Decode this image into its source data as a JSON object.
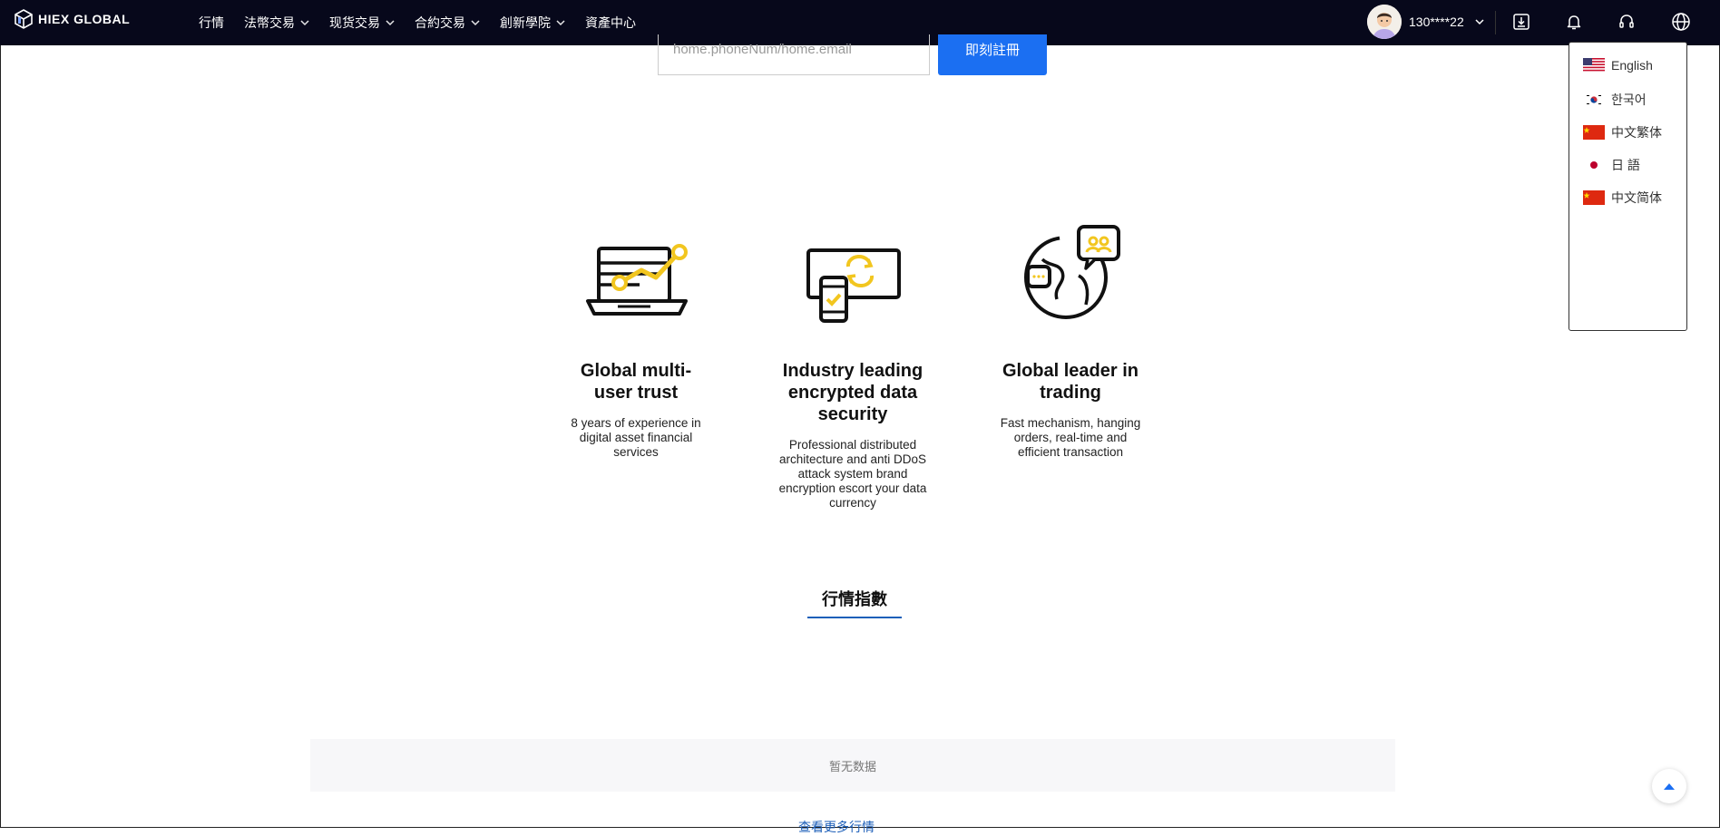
{
  "brand": {
    "logo_text": "HIEX GLOBAL"
  },
  "nav": {
    "items": [
      {
        "label": "行情",
        "has_dropdown": false
      },
      {
        "label": "法幣交易",
        "has_dropdown": true
      },
      {
        "label": "现货交易",
        "has_dropdown": true
      },
      {
        "label": "合約交易",
        "has_dropdown": true
      },
      {
        "label": "創新學院",
        "has_dropdown": true
      },
      {
        "label": "資產中心",
        "has_dropdown": false
      }
    ]
  },
  "user": {
    "id": "130****22"
  },
  "icons": [
    "download-icon",
    "bell-icon",
    "headset-icon",
    "globe-icon"
  ],
  "language_menu": {
    "items": [
      {
        "label": "English",
        "flag": "us-flag-icon"
      },
      {
        "label": "한국어",
        "flag": "kr-flag-icon"
      },
      {
        "label": "中文繁体",
        "flag": "cn-flag-icon"
      },
      {
        "label": "日 語",
        "flag": "jp-flag-icon"
      },
      {
        "label": "中文简体",
        "flag": "cn-flag-icon"
      }
    ]
  },
  "register": {
    "placeholder": "home.phoneNum/home.email",
    "button_label": "即刻註冊"
  },
  "features": [
    {
      "title": "Global multi-user trust",
      "desc": "8 years of experience in digital asset financial services",
      "icon": "laptop-chart-icon"
    },
    {
      "title": "Industry leading encrypted data security",
      "desc": "Professional distributed architecture and anti DDoS attack system brand encryption escort your data currency",
      "icon": "devices-sync-icon"
    },
    {
      "title": "Global leader in trading",
      "desc": "Fast mechanism, hanging orders, real-time and efficient transaction",
      "icon": "globe-chat-icon"
    }
  ],
  "market": {
    "title": "行情指數",
    "empty_text": "暂无数据",
    "more_link": "查看更多行情"
  },
  "colors": {
    "topbar_bg": "#07081b",
    "accent_blue": "#1b6ff2",
    "icon_yellow": "#f2c61f"
  }
}
